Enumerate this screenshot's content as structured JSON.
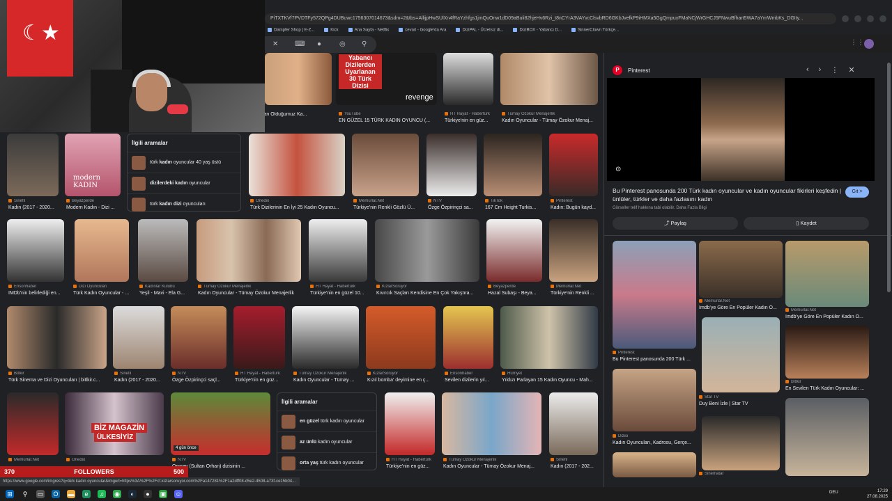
{
  "browser": {
    "url": "PiTXTKVf7PVDTFy572QPg4DUBuwc1756307014673&sdm=2&tbs=AllijpHwSUlXn4fRaYzhfgs1jmQuOnw1dD09aBuli82hjeHv6Rzi_t8nCYrA3VAYvcClsvbRD6GKbJvefkP9iHMXa5GgQmpuxFMaNCjWrGHCJ5FNwuBfhart5WA7aYmWmbKs_DGIty...",
    "bookmarks": [
      "Dampfer Shop | E-Z...",
      "Kick",
      "Ana Sayfa - Netflix",
      "cevari - Google'da Ara",
      "DiziPAL - Ücretsiz di...",
      "DiziBOX - Yabancı D...",
      "SinnerClown Türkçe..."
    ]
  },
  "results": [
    {
      "src": "",
      "title": "na Hayran Olduğumuz Ka..."
    },
    {
      "src": "YouTube",
      "title": "EN GÜZEL 15 TÜRK KADIN OYUNCU (..."
    },
    {
      "src": "HT Hayat - Habertürk",
      "title": "Türkiye'nin en güz..."
    },
    {
      "src": "Tümay Özokur Menajerlik",
      "title": "Kadın Oyuncular - Tümay Özokur Menaj..."
    },
    {
      "src": "Sinefil",
      "title": "Kadın (2017 - 2020..."
    },
    {
      "src": "Beyazperde",
      "title": "Modern Kadın - Dizi ..."
    },
    {
      "src": "Onedio",
      "title": "Türk Dizilerinin En İyi 25 Kadın Oyuncu..."
    },
    {
      "src": "Memurlar.Net",
      "title": "Türkiye'nin Renkli Gözlü Ü..."
    },
    {
      "src": "NTV",
      "title": "Özge Özpirinçci sa..."
    },
    {
      "src": "TikTok",
      "title": "167 Cm Height Turkis..."
    },
    {
      "src": "Pinterest",
      "title": "Kadın: Bugün kayd..."
    },
    {
      "src": "Ensonhaber",
      "title": "IMDb'nin belirlediği en..."
    },
    {
      "src": "Dizi Oyuncuları",
      "title": "Türk Kadın Oyuncular - ..."
    },
    {
      "src": "Kadınlar Kulübü",
      "title": "Yeşil - Mavi - Ela G..."
    },
    {
      "src": "Tümay Özokur Menajerlik",
      "title": "Kadın Oyuncular - Tümay Özokur Menajerlik"
    },
    {
      "src": "HT Hayat - Habertürk",
      "title": "Türkiye'nin en güzel 10..."
    },
    {
      "src": "KizlarSoruyor",
      "title": "Kıvırcık Saçları Kendisine En Çok Yakıştıra..."
    },
    {
      "src": "Beyazperde",
      "title": "Hazal Subaşı - Beya..."
    },
    {
      "src": "Memurlar.Net",
      "title": "Türkiye'nin Renkli ..."
    },
    {
      "src": "Bitlkir",
      "title": "Türk Sinema ve Dizi Oyuncuları | bitlkir.c..."
    },
    {
      "src": "Sinefil",
      "title": "Kadın (2017 - 2020..."
    },
    {
      "src": "NTV",
      "title": "Özge Özpirinçci saçl..."
    },
    {
      "src": "HT Hayat - Habertürk",
      "title": "Türkiye'nin en güz..."
    },
    {
      "src": "Tümay Özokur Menajerlik",
      "title": "Kadın Oyuncular - Tümay ..."
    },
    {
      "src": "KizlarSoruyor",
      "title": "Kızıl bomba' deyimine en ç..."
    },
    {
      "src": "Ensonhaber",
      "title": "Sevilen dizilerin yıl..."
    },
    {
      "src": "Hürriyet",
      "title": "Yıldızı Parlayan 15 Kadın Oyuncu - Mah..."
    },
    {
      "src": "Memurlar.Net",
      "title": ""
    },
    {
      "src": "Onedio",
      "title": ""
    },
    {
      "src": "NTV",
      "title": "Osman (Sultan Orhan) dizisinin ..."
    },
    {
      "src": "HT Hayat - Habertürk",
      "title": "Türkiye'nin en güz..."
    },
    {
      "src": "Tümay Özokur Menajerlik",
      "title": "Kadın Oyuncular - Tümay Özokur Menaj..."
    },
    {
      "src": "Sinefil",
      "title": "Kadın (2017 - 202..."
    }
  ],
  "related1": {
    "heading": "İlgili aramalar",
    "items": [
      {
        "pre": "türk ",
        "bold": "kadın",
        "post": " oyuncular 40 yaş üstü"
      },
      {
        "pre": "",
        "bold": "dizilerdeki kadın",
        "post": " oyuncular"
      },
      {
        "pre": "türk ",
        "bold": "kadın dizi",
        "post": " oyuncuları"
      }
    ]
  },
  "related2": {
    "heading": "İlgili aramalar",
    "items": [
      {
        "pre": "",
        "bold": "en güzel",
        "post": " türk kadın oyuncular"
      },
      {
        "pre": "",
        "bold": "az ünlü",
        "post": " kadın oyuncular"
      },
      {
        "pre": "",
        "bold": "orta yaş",
        "post": " türk kadın oyuncular"
      }
    ]
  },
  "thumb_text": {
    "yt_lines": [
      "Yabancı",
      "Dizilerden",
      "Uyarlanan",
      "30 Türk",
      "Dizisi"
    ],
    "revenge": "revenge",
    "modern_kadin": "modern KADIN",
    "biz_magazin": "BİZ MAGAZİN",
    "ulkesiyiz": "ÜLKESİYİZ",
    "days_ago": "4 gün önce"
  },
  "side": {
    "source": "Pinterest",
    "description": "Bu Pinterest panosunda 200 Türk kadın oyuncular ve kadın oyuncular fikirleri keşfedin | ünlüler, türkler ve daha fazlasını kadın",
    "subnote": "Görseller telif hakkına tabi olabilir. Daha Fazla Bilgi",
    "git": "Git >",
    "share": "Paylaş",
    "save": "Kaydet",
    "cards": [
      {
        "src": "Pinterest",
        "title": "Bu Pinterest panosunda 200 Türk ..."
      },
      {
        "src": "Memurlar.Net",
        "title": "Imdb'ye Göre En Popüler Kadın O..."
      },
      {
        "src": "Memurlar.Net",
        "title": "Imdb'ye Göre En Popüler Kadın O..."
      },
      {
        "src": "Star TV",
        "title": "Duy Beni İzle | Star TV"
      },
      {
        "src": "Bitlkir",
        "title": "En Sevilen Türk Kadın Oyuncular: ..."
      },
      {
        "src": "Dizisi",
        "title": "Kadın Oyuncuları, Kadrosu, Gerçe..."
      },
      {
        "src": "Sinematar",
        "title": ""
      }
    ]
  },
  "stream": {
    "left": "370",
    "label": "FOLLOWERS",
    "right": "500"
  },
  "status_url": "https://www.google.com/imgres?q=türk kadın oyuncular&imgurl=https%3A%2F%2Fcf.kizlarsoruyor.com%2Fa147281%2F1a2dff08-d5e2-4508-a73f-ce15b04...",
  "taskbar": {
    "lang": "DEU",
    "time": "17:29",
    "date": "27.08.2025"
  }
}
